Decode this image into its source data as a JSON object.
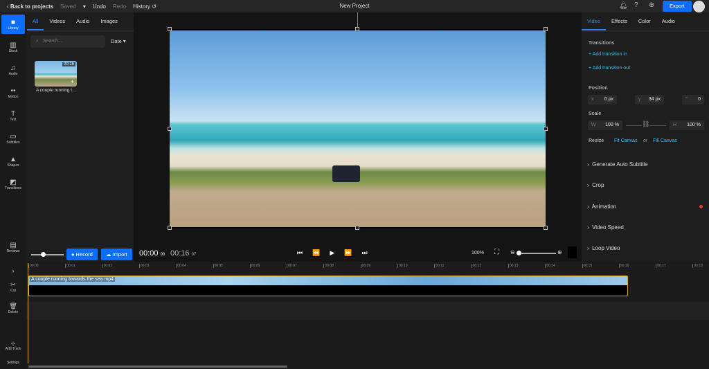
{
  "topbar": {
    "back": "Back to projects",
    "saved": "Saved",
    "undo": "Undo",
    "redo": "Redo",
    "history": "History",
    "title": "New Project",
    "export": "Export"
  },
  "rail": [
    {
      "label": "Library",
      "icon": "folder-icon"
    },
    {
      "label": "Stock",
      "icon": "books-icon"
    },
    {
      "label": "Audio",
      "icon": "music-icon"
    },
    {
      "label": "Motion",
      "icon": "motion-icon"
    },
    {
      "label": "Text",
      "icon": "text-icon"
    },
    {
      "label": "Subtitles",
      "icon": "subtitles-icon"
    },
    {
      "label": "Shapes",
      "icon": "shapes-icon"
    },
    {
      "label": "Transitions",
      "icon": "transitions-icon"
    }
  ],
  "reviews": "Reviews",
  "library": {
    "tabs": [
      "All",
      "Videos",
      "Audio",
      "Images"
    ],
    "search_placeholder": "Search...",
    "sort": "Date",
    "item": {
      "duration": "00:16",
      "name": "A couple running t..."
    }
  },
  "controls": {
    "record": "Record",
    "import": "Import",
    "current": "00:00",
    "current_frames": "00",
    "total": "00:16",
    "total_frames": "07",
    "zoom": "100%"
  },
  "props": {
    "tabs": [
      "Video",
      "Effects",
      "Color",
      "Audio"
    ],
    "transitions": "Transitions",
    "add_in": "Add transition in",
    "add_out": "Add transition out",
    "position": "Position",
    "x": "0 px",
    "y": "34 px",
    "rotation": "0",
    "scale": "Scale",
    "w": "100 %",
    "h": "100 %",
    "resize": "Resize",
    "fit": "Fit Canvas",
    "or": "or",
    "fill": "Fill Canvas",
    "sections": [
      "Generate Auto Subtitle",
      "Crop",
      "Animation",
      "Video Speed",
      "Loop Video"
    ]
  },
  "timeline": {
    "tools": [
      "Cut",
      "Delete",
      "Add Track",
      "Settings"
    ],
    "ticks": [
      "00:00",
      "00:01",
      "00:02",
      "00:03",
      "00:04",
      "00:05",
      "00:06",
      "00:07",
      "00:08",
      "00:09",
      "00:10",
      "00:11",
      "00:12",
      "00:13",
      "00:14",
      "00:15",
      "00:16",
      "00:17",
      "00:18"
    ],
    "clip": "A couple running towards the sea.mp4"
  },
  "colors": {
    "accent": "#0d6efd",
    "link": "#38bdf8",
    "clip_border": "#d4a72c"
  }
}
